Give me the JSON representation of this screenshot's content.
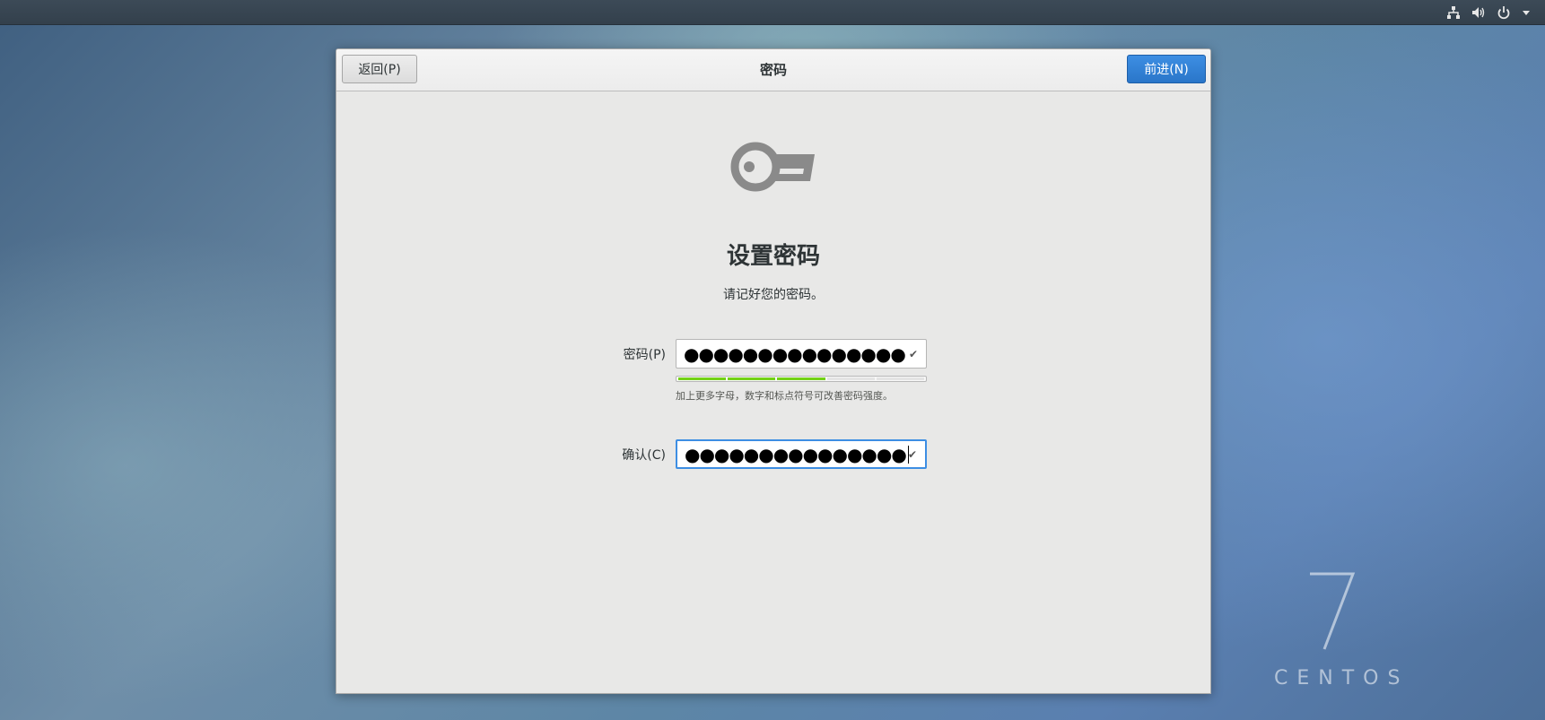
{
  "topbar": {
    "icons": [
      "network-icon",
      "volume-icon",
      "power-icon",
      "menu-arrow-icon"
    ]
  },
  "dialog": {
    "title": "密码",
    "back_label": "返回(P)",
    "next_label": "前进(N)",
    "icon": "key-icon",
    "heading": "设置密码",
    "subtitle": "请记好您的密码。",
    "password_label": "密码(P)",
    "password_value": "●●●●●●●●●●●●●●●",
    "password_valid_icon": "check-icon",
    "strength": 0.6,
    "strength_hint": "加上更多字母，数字和标点符号可改善密码强度。",
    "confirm_label": "确认(C)",
    "confirm_value": "●●●●●●●●●●●●●●●",
    "confirm_valid_icon": "check-icon"
  },
  "branding": {
    "version": "7",
    "name": "CENTOS"
  },
  "colors": {
    "accent": "#3d8ee3",
    "strength_on": "#73d216",
    "dialog_bg": "#e8e8e7"
  }
}
